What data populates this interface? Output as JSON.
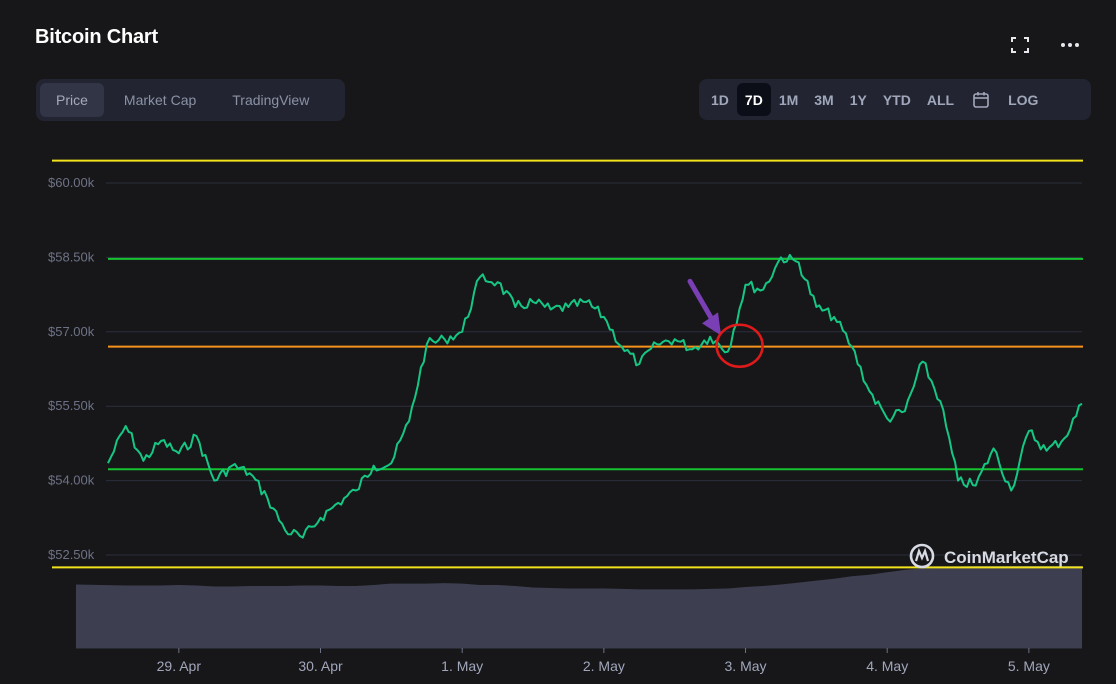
{
  "header": {
    "title": "Bitcoin Chart"
  },
  "icons": {
    "fullscreen": "fullscreen-icon",
    "more": "more-icon",
    "calendar": "calendar-icon"
  },
  "tabs": [
    {
      "label": "Price",
      "active": true
    },
    {
      "label": "Market Cap",
      "active": false
    },
    {
      "label": "TradingView",
      "active": false
    }
  ],
  "ranges": [
    {
      "label": "1D",
      "active": false
    },
    {
      "label": "7D",
      "active": true
    },
    {
      "label": "1M",
      "active": false
    },
    {
      "label": "3M",
      "active": false
    },
    {
      "label": "1Y",
      "active": false
    },
    {
      "label": "YTD",
      "active": false
    },
    {
      "label": "ALL",
      "active": false
    },
    {
      "label": "LOG",
      "active": false
    }
  ],
  "watermark": "CoinMarketCap",
  "colors": {
    "price_line": "#16c784",
    "support_resistance": "#17c230",
    "mid_line": "#f7931a",
    "bounds": "#f2e31d",
    "volume": "#3d3f50",
    "annotation_arrow": "#7b3fb5",
    "annotation_circle": "#e01a1a"
  },
  "chart_data": {
    "type": "line",
    "ylim": [
      52000,
      61200
    ],
    "yticks": [
      {
        "value": 52500,
        "label": "$52.50k"
      },
      {
        "value": 54000,
        "label": "$54.00k"
      },
      {
        "value": 55500,
        "label": "$55.50k"
      },
      {
        "value": 57000,
        "label": "$57.00k"
      },
      {
        "value": 58500,
        "label": "$58.50k"
      },
      {
        "value": 60000,
        "label": "$60.00k"
      }
    ],
    "xlim": [
      "2021-04-28T12:00",
      "2021-05-05T09:00"
    ],
    "xticks": [
      {
        "value": "2021-04-29T00:00",
        "label": "29. Apr"
      },
      {
        "value": "2021-04-30T00:00",
        "label": "30. Apr"
      },
      {
        "value": "2021-05-01T00:00",
        "label": "1. May"
      },
      {
        "value": "2021-05-02T00:00",
        "label": "2. May"
      },
      {
        "value": "2021-05-03T00:00",
        "label": "3. May"
      },
      {
        "value": "2021-05-04T00:00",
        "label": "4. May"
      },
      {
        "value": "2021-05-05T00:00",
        "label": "5. May"
      }
    ],
    "horizontal_lines": [
      {
        "value": 60450,
        "role": "upper-bound",
        "color": "#f2e31d"
      },
      {
        "value": 58470,
        "role": "resistance",
        "color": "#17c230"
      },
      {
        "value": 56700,
        "role": "middle",
        "color": "#f7931a"
      },
      {
        "value": 54230,
        "role": "support",
        "color": "#17c230"
      },
      {
        "value": 52250,
        "role": "lower-bound",
        "color": "#f2e31d"
      }
    ],
    "series": [
      {
        "x": [
          "2021-04-28T12:00",
          "2021-04-28T15:00",
          "2021-04-28T18:00",
          "2021-04-28T21:00",
          "2021-04-29T00:00",
          "2021-04-29T03:00",
          "2021-04-29T06:00",
          "2021-04-29T09:00",
          "2021-04-29T12:00",
          "2021-04-29T15:00",
          "2021-04-29T18:00",
          "2021-04-29T21:00",
          "2021-04-30T00:00",
          "2021-04-30T03:00",
          "2021-04-30T06:00",
          "2021-04-30T09:00",
          "2021-04-30T12:00",
          "2021-04-30T15:00",
          "2021-04-30T18:00",
          "2021-04-30T21:00",
          "2021-05-01T00:00",
          "2021-05-01T03:00",
          "2021-05-01T06:00",
          "2021-05-01T09:00",
          "2021-05-01T12:00",
          "2021-05-01T15:00",
          "2021-05-01T18:00",
          "2021-05-01T21:00",
          "2021-05-02T00:00",
          "2021-05-02T03:00",
          "2021-05-02T06:00",
          "2021-05-02T09:00",
          "2021-05-02T12:00",
          "2021-05-02T15:00",
          "2021-05-02T18:00",
          "2021-05-02T21:00",
          "2021-05-03T00:00",
          "2021-05-03T03:00",
          "2021-05-03T06:00",
          "2021-05-03T09:00",
          "2021-05-03T12:00",
          "2021-05-03T15:00",
          "2021-05-03T18:00",
          "2021-05-03T21:00",
          "2021-05-04T00:00",
          "2021-05-04T03:00",
          "2021-05-04T06:00",
          "2021-05-04T09:00",
          "2021-05-04T12:00",
          "2021-05-04T15:00",
          "2021-05-04T18:00",
          "2021-05-04T21:00",
          "2021-05-05T00:00",
          "2021-05-05T03:00",
          "2021-05-05T06:00",
          "2021-05-05T09:00"
        ],
        "y": [
          54350,
          55100,
          54400,
          54800,
          54550,
          54900,
          54000,
          54300,
          54150,
          53650,
          53000,
          52850,
          53250,
          53550,
          53800,
          54300,
          54350,
          55200,
          56750,
          56850,
          57000,
          58100,
          58000,
          57500,
          57600,
          57450,
          57500,
          57600,
          57300,
          56700,
          56350,
          56750,
          56850,
          56650,
          56900,
          56600,
          57950,
          57850,
          58500,
          58400,
          57500,
          57300,
          56700,
          55800,
          55250,
          55400,
          56400,
          55600,
          54000,
          53900,
          54650,
          53800,
          55000,
          54600,
          54850,
          55550
        ]
      }
    ],
    "volume": [
      130,
      128,
      128,
      128,
      129,
      128,
      126,
      126,
      127,
      127,
      127,
      128,
      128,
      127,
      127,
      129,
      132,
      132,
      132,
      133,
      132,
      129,
      129,
      127,
      124,
      123,
      122,
      122,
      122,
      121,
      120,
      120,
      120,
      120,
      121,
      122,
      125,
      127,
      130,
      134,
      138,
      142,
      147,
      150,
      155,
      160,
      163,
      165,
      167,
      168,
      168,
      168,
      168,
      168,
      168,
      168
    ],
    "annotations": [
      {
        "type": "arrow",
        "x": "2021-05-02T19:00",
        "y": 57050,
        "color": "#7b3fb5"
      },
      {
        "type": "circle",
        "x": "2021-05-02T23:00",
        "y": 56720,
        "color": "#e01a1a"
      }
    ]
  }
}
